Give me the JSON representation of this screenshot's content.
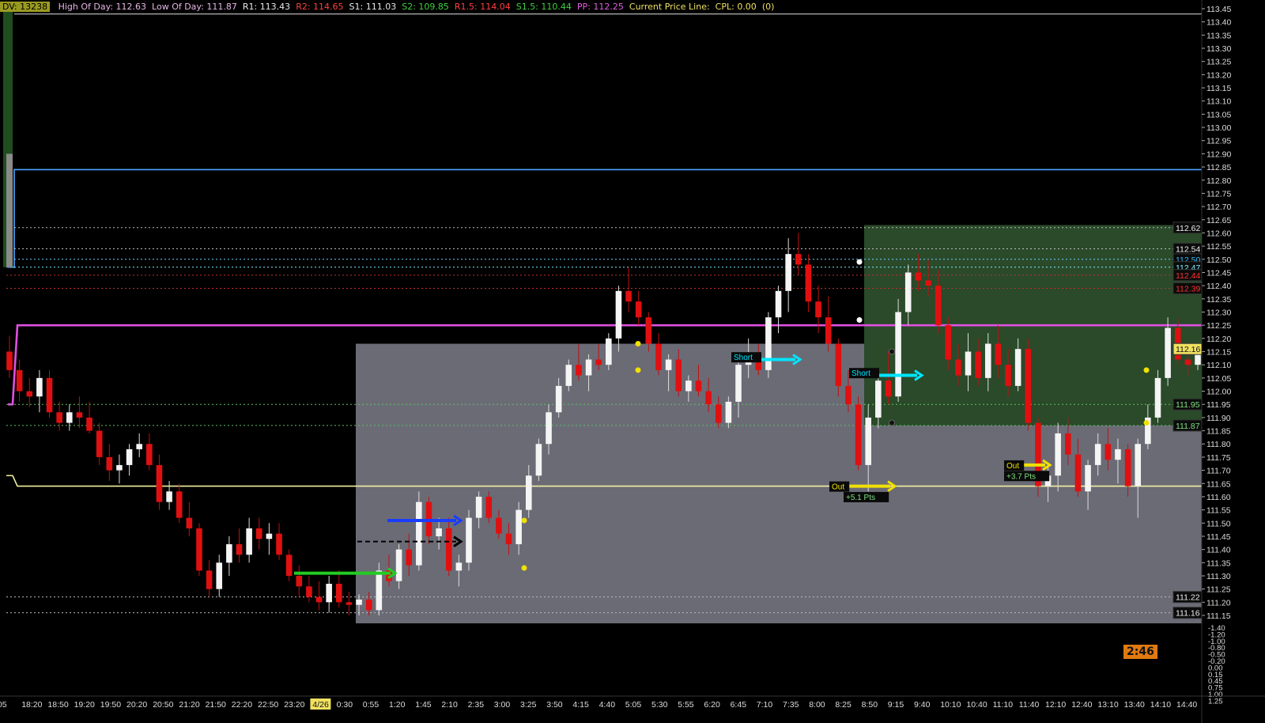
{
  "header": {
    "dv_label": "DV: 13238",
    "items": [
      {
        "text": "High Of Day: 112.63",
        "color": "#e7b7e7"
      },
      {
        "text": "Low Of Day: 111.87",
        "color": "#e7b7e7"
      },
      {
        "text": "R1: 113.43",
        "color": "#e8e8e8"
      },
      {
        "text": "R2: 114.65",
        "color": "#ff4040"
      },
      {
        "text": "S1: 111.03",
        "color": "#e8e8e8"
      },
      {
        "text": "S2: 109.85",
        "color": "#3fd13f"
      },
      {
        "text": "R1.5: 114.04",
        "color": "#ff4040"
      },
      {
        "text": "S1.5: 110.44",
        "color": "#3fd13f"
      },
      {
        "text": "PP: 112.25",
        "color": "#e060e0"
      },
      {
        "text": "Current Price Line:",
        "color": "#f0e060"
      },
      {
        "text": "CPL: 0.00",
        "color": "#f0e060"
      },
      {
        "text": "(0)",
        "color": "#f0e060"
      }
    ]
  },
  "clock": {
    "value": "2:46"
  },
  "chart_data": {
    "type": "candlestick",
    "y_axis_ticks": [
      "113.45",
      "113.40",
      "113.35",
      "113.30",
      "113.25",
      "113.20",
      "113.15",
      "113.10",
      "113.05",
      "113.00",
      "112.95",
      "112.90",
      "112.85",
      "112.80",
      "112.75",
      "112.70",
      "112.65",
      "112.60",
      "112.55",
      "112.50",
      "112.45",
      "112.40",
      "112.35",
      "112.30",
      "112.25",
      "112.20",
      "112.15",
      "112.10",
      "112.05",
      "112.00",
      "111.95",
      "111.90",
      "111.85",
      "111.80",
      "111.75",
      "111.70",
      "111.65",
      "111.60",
      "111.55",
      "111.50",
      "111.45",
      "111.40",
      "111.35",
      "111.30",
      "111.25",
      "111.20",
      "111.15"
    ],
    "y_range": [
      111.12,
      113.47
    ],
    "indicator_ticks": [
      "-1.40",
      "-1.20",
      "-1.00",
      "-0.80",
      "-0.50",
      "-0.20",
      "0.00",
      "0.15",
      "0.45",
      "0.75",
      "1.00",
      "1.25"
    ],
    "x_axis_ticks": [
      ":05",
      "18:20",
      "18:50",
      "19:20",
      "19:50",
      "20:20",
      "20:50",
      "21:20",
      "21:50",
      "22:20",
      "22:50",
      "23:20",
      "4/26",
      "0:30",
      "0:55",
      "1:20",
      "1:45",
      "2:10",
      "2:35",
      "3:00",
      "3:25",
      "3:50",
      "4:15",
      "4:40",
      "5:05",
      "5:30",
      "5:55",
      "6:20",
      "6:45",
      "7:10",
      "7:35",
      "8:00",
      "8:25",
      "8:50",
      "9:15",
      "9:40",
      "10:10",
      "10:40",
      "11:10",
      "11:40",
      "12:10",
      "12:40",
      "13:10",
      "13:40",
      "14:10",
      "14:40"
    ],
    "price_labels": [
      {
        "text": "112.62",
        "value": 112.62,
        "color": "#eeeeee"
      },
      {
        "text": "112.54",
        "value": 112.54,
        "color": "#eeeeee"
      },
      {
        "text": "112.50",
        "value": 112.5,
        "color": "#33bfff"
      },
      {
        "text": "112.47",
        "value": 112.47,
        "color": "#7ff0ff"
      },
      {
        "text": "112.44",
        "value": 112.44,
        "color": "#ff3030"
      },
      {
        "text": "112.39",
        "value": 112.39,
        "color": "#ff3030"
      },
      {
        "text": "112.16",
        "value": 112.16,
        "color": "#111111",
        "bg": "#f0e060"
      },
      {
        "text": "111.95",
        "value": 111.95,
        "color": "#7fe07f"
      },
      {
        "text": "111.87",
        "value": 111.87,
        "color": "#7fe07f"
      },
      {
        "text": "111.22",
        "value": 111.22,
        "color": "#eeeeee"
      },
      {
        "text": "111.16",
        "value": 111.16,
        "color": "#eeeeee"
      }
    ],
    "levels": {
      "r1": 113.43,
      "blue_line": 112.84,
      "pivot": 112.25,
      "yellow_line": 111.64,
      "dotted": [
        112.62,
        112.54,
        112.5,
        112.47,
        112.44,
        112.39,
        111.95,
        111.87,
        111.22,
        111.16
      ]
    },
    "zones": {
      "gray_range": [
        111.12,
        112.18
      ],
      "green_range": [
        111.87,
        112.63
      ]
    },
    "annotations": [
      {
        "text": "Short",
        "color": "#00e5ff"
      },
      {
        "text": "Short",
        "color": "#00e5ff"
      },
      {
        "text": "Out",
        "color": "#f0e000"
      },
      {
        "text": "+5.1 Pts",
        "color": "#7fe07f"
      },
      {
        "text": "Out",
        "color": "#f0e000"
      },
      {
        "text": "+3.7 Pts",
        "color": "#7fe07f"
      }
    ],
    "candles": [
      [
        112.15,
        112.21,
        112.05,
        112.08
      ],
      [
        112.08,
        112.12,
        111.96,
        112.0
      ],
      [
        112.0,
        112.05,
        111.94,
        111.98
      ],
      [
        111.98,
        112.08,
        111.92,
        112.05
      ],
      [
        112.05,
        112.08,
        111.9,
        111.92
      ],
      [
        111.92,
        111.96,
        111.85,
        111.88
      ],
      [
        111.88,
        111.95,
        111.85,
        111.92
      ],
      [
        111.92,
        111.98,
        111.86,
        111.9
      ],
      [
        111.9,
        111.96,
        111.84,
        111.85
      ],
      [
        111.85,
        111.88,
        111.72,
        111.75
      ],
      [
        111.75,
        111.8,
        111.66,
        111.7
      ],
      [
        111.7,
        111.76,
        111.65,
        111.72
      ],
      [
        111.72,
        111.8,
        111.68,
        111.78
      ],
      [
        111.78,
        111.84,
        111.75,
        111.8
      ],
      [
        111.8,
        111.84,
        111.7,
        111.72
      ],
      [
        111.72,
        111.76,
        111.55,
        111.58
      ],
      [
        111.58,
        111.66,
        111.55,
        111.62
      ],
      [
        111.62,
        111.65,
        111.5,
        111.52
      ],
      [
        111.52,
        111.58,
        111.45,
        111.48
      ],
      [
        111.48,
        111.5,
        111.3,
        111.32
      ],
      [
        111.32,
        111.36,
        111.22,
        111.25
      ],
      [
        111.25,
        111.38,
        111.22,
        111.35
      ],
      [
        111.35,
        111.45,
        111.3,
        111.42
      ],
      [
        111.42,
        111.48,
        111.35,
        111.38
      ],
      [
        111.38,
        111.52,
        111.35,
        111.48
      ],
      [
        111.48,
        111.52,
        111.4,
        111.44
      ],
      [
        111.44,
        111.5,
        111.38,
        111.46
      ],
      [
        111.46,
        111.5,
        111.36,
        111.38
      ],
      [
        111.38,
        111.4,
        111.28,
        111.3
      ],
      [
        111.3,
        111.34,
        111.22,
        111.26
      ],
      [
        111.26,
        111.3,
        111.2,
        111.22
      ],
      [
        111.22,
        111.28,
        111.17,
        111.2
      ],
      [
        111.2,
        111.3,
        111.16,
        111.27
      ],
      [
        111.27,
        111.32,
        111.18,
        111.2
      ],
      [
        111.2,
        111.24,
        111.15,
        111.19
      ],
      [
        111.19,
        111.23,
        111.15,
        111.21
      ],
      [
        111.21,
        111.24,
        111.15,
        111.17
      ],
      [
        111.17,
        111.35,
        111.15,
        111.32
      ],
      [
        111.32,
        111.38,
        111.26,
        111.28
      ],
      [
        111.28,
        111.42,
        111.25,
        111.4
      ],
      [
        111.4,
        111.46,
        111.3,
        111.34
      ],
      [
        111.34,
        111.62,
        111.32,
        111.58
      ],
      [
        111.58,
        111.6,
        111.42,
        111.45
      ],
      [
        111.45,
        111.52,
        111.4,
        111.48
      ],
      [
        111.48,
        111.52,
        111.3,
        111.32
      ],
      [
        111.32,
        111.38,
        111.26,
        111.35
      ],
      [
        111.35,
        111.55,
        111.32,
        111.52
      ],
      [
        111.52,
        111.62,
        111.48,
        111.6
      ],
      [
        111.6,
        111.62,
        111.5,
        111.52
      ],
      [
        111.52,
        111.55,
        111.44,
        111.46
      ],
      [
        111.46,
        111.5,
        111.38,
        111.42
      ],
      [
        111.42,
        111.58,
        111.38,
        111.55
      ],
      [
        111.55,
        111.72,
        111.52,
        111.68
      ],
      [
        111.68,
        111.82,
        111.66,
        111.8
      ],
      [
        111.8,
        111.95,
        111.76,
        111.92
      ],
      [
        111.92,
        112.05,
        111.9,
        112.02
      ],
      [
        112.02,
        112.12,
        112.0,
        112.1
      ],
      [
        112.1,
        112.18,
        112.04,
        112.06
      ],
      [
        112.06,
        112.14,
        112.0,
        112.12
      ],
      [
        112.12,
        112.18,
        112.08,
        112.1
      ],
      [
        112.1,
        112.22,
        112.08,
        112.2
      ],
      [
        112.2,
        112.4,
        112.15,
        112.38
      ],
      [
        112.38,
        112.47,
        112.3,
        112.34
      ],
      [
        112.34,
        112.38,
        112.25,
        112.28
      ],
      [
        112.28,
        112.3,
        112.15,
        112.18
      ],
      [
        112.18,
        112.22,
        112.06,
        112.08
      ],
      [
        112.08,
        112.14,
        112.0,
        112.12
      ],
      [
        112.12,
        112.16,
        111.98,
        112.0
      ],
      [
        112.0,
        112.06,
        111.96,
        112.04
      ],
      [
        112.04,
        112.1,
        111.98,
        112.0
      ],
      [
        112.0,
        112.05,
        111.92,
        111.95
      ],
      [
        111.95,
        111.98,
        111.86,
        111.88
      ],
      [
        111.88,
        111.98,
        111.86,
        111.96
      ],
      [
        111.96,
        112.12,
        111.9,
        112.1
      ],
      [
        112.1,
        112.2,
        112.05,
        112.12
      ],
      [
        112.12,
        112.18,
        112.06,
        112.08
      ],
      [
        112.08,
        112.3,
        112.05,
        112.28
      ],
      [
        112.28,
        112.4,
        112.22,
        112.38
      ],
      [
        112.38,
        112.58,
        112.3,
        112.52
      ],
      [
        112.52,
        112.6,
        112.44,
        112.48
      ],
      [
        112.48,
        112.52,
        112.3,
        112.34
      ],
      [
        112.34,
        112.4,
        112.22,
        112.28
      ],
      [
        112.28,
        112.36,
        112.15,
        112.18
      ],
      [
        112.18,
        112.2,
        111.98,
        112.02
      ],
      [
        112.02,
        112.08,
        111.92,
        111.95
      ],
      [
        111.95,
        111.98,
        111.7,
        111.72
      ],
      [
        111.72,
        111.95,
        111.62,
        111.9
      ],
      [
        111.9,
        112.08,
        111.86,
        112.04
      ],
      [
        112.04,
        112.15,
        111.95,
        111.98
      ],
      [
        111.98,
        112.35,
        111.96,
        112.3
      ],
      [
        112.3,
        112.48,
        112.25,
        112.45
      ],
      [
        112.45,
        112.52,
        112.38,
        112.42
      ],
      [
        112.42,
        112.5,
        112.36,
        112.4
      ],
      [
        112.4,
        112.46,
        112.22,
        112.25
      ],
      [
        112.25,
        112.28,
        112.08,
        112.12
      ],
      [
        112.12,
        112.18,
        112.02,
        112.06
      ],
      [
        112.06,
        112.22,
        112.0,
        112.15
      ],
      [
        112.15,
        112.2,
        112.02,
        112.05
      ],
      [
        112.05,
        112.22,
        112.0,
        112.18
      ],
      [
        112.18,
        112.25,
        112.05,
        112.1
      ],
      [
        112.1,
        112.16,
        111.98,
        112.02
      ],
      [
        112.02,
        112.2,
        112.0,
        112.16
      ],
      [
        112.16,
        112.2,
        111.85,
        111.88
      ],
      [
        111.88,
        111.9,
        111.6,
        111.64
      ],
      [
        111.64,
        111.72,
        111.58,
        111.68
      ],
      [
        111.68,
        111.88,
        111.62,
        111.84
      ],
      [
        111.84,
        111.9,
        111.72,
        111.76
      ],
      [
        111.76,
        111.82,
        111.6,
        111.62
      ],
      [
        111.62,
        111.74,
        111.55,
        111.72
      ],
      [
        111.72,
        111.84,
        111.68,
        111.8
      ],
      [
        111.8,
        111.86,
        111.7,
        111.74
      ],
      [
        111.74,
        111.82,
        111.65,
        111.78
      ],
      [
        111.78,
        111.8,
        111.6,
        111.64
      ],
      [
        111.64,
        111.82,
        111.52,
        111.8
      ],
      [
        111.8,
        111.95,
        111.78,
        111.9
      ],
      [
        111.9,
        112.08,
        111.88,
        112.05
      ],
      [
        112.05,
        112.28,
        112.02,
        112.24
      ],
      [
        112.24,
        112.28,
        112.1,
        112.12
      ],
      [
        112.12,
        112.16,
        112.06,
        112.1
      ],
      [
        112.1,
        112.18,
        112.08,
        112.16
      ]
    ]
  }
}
